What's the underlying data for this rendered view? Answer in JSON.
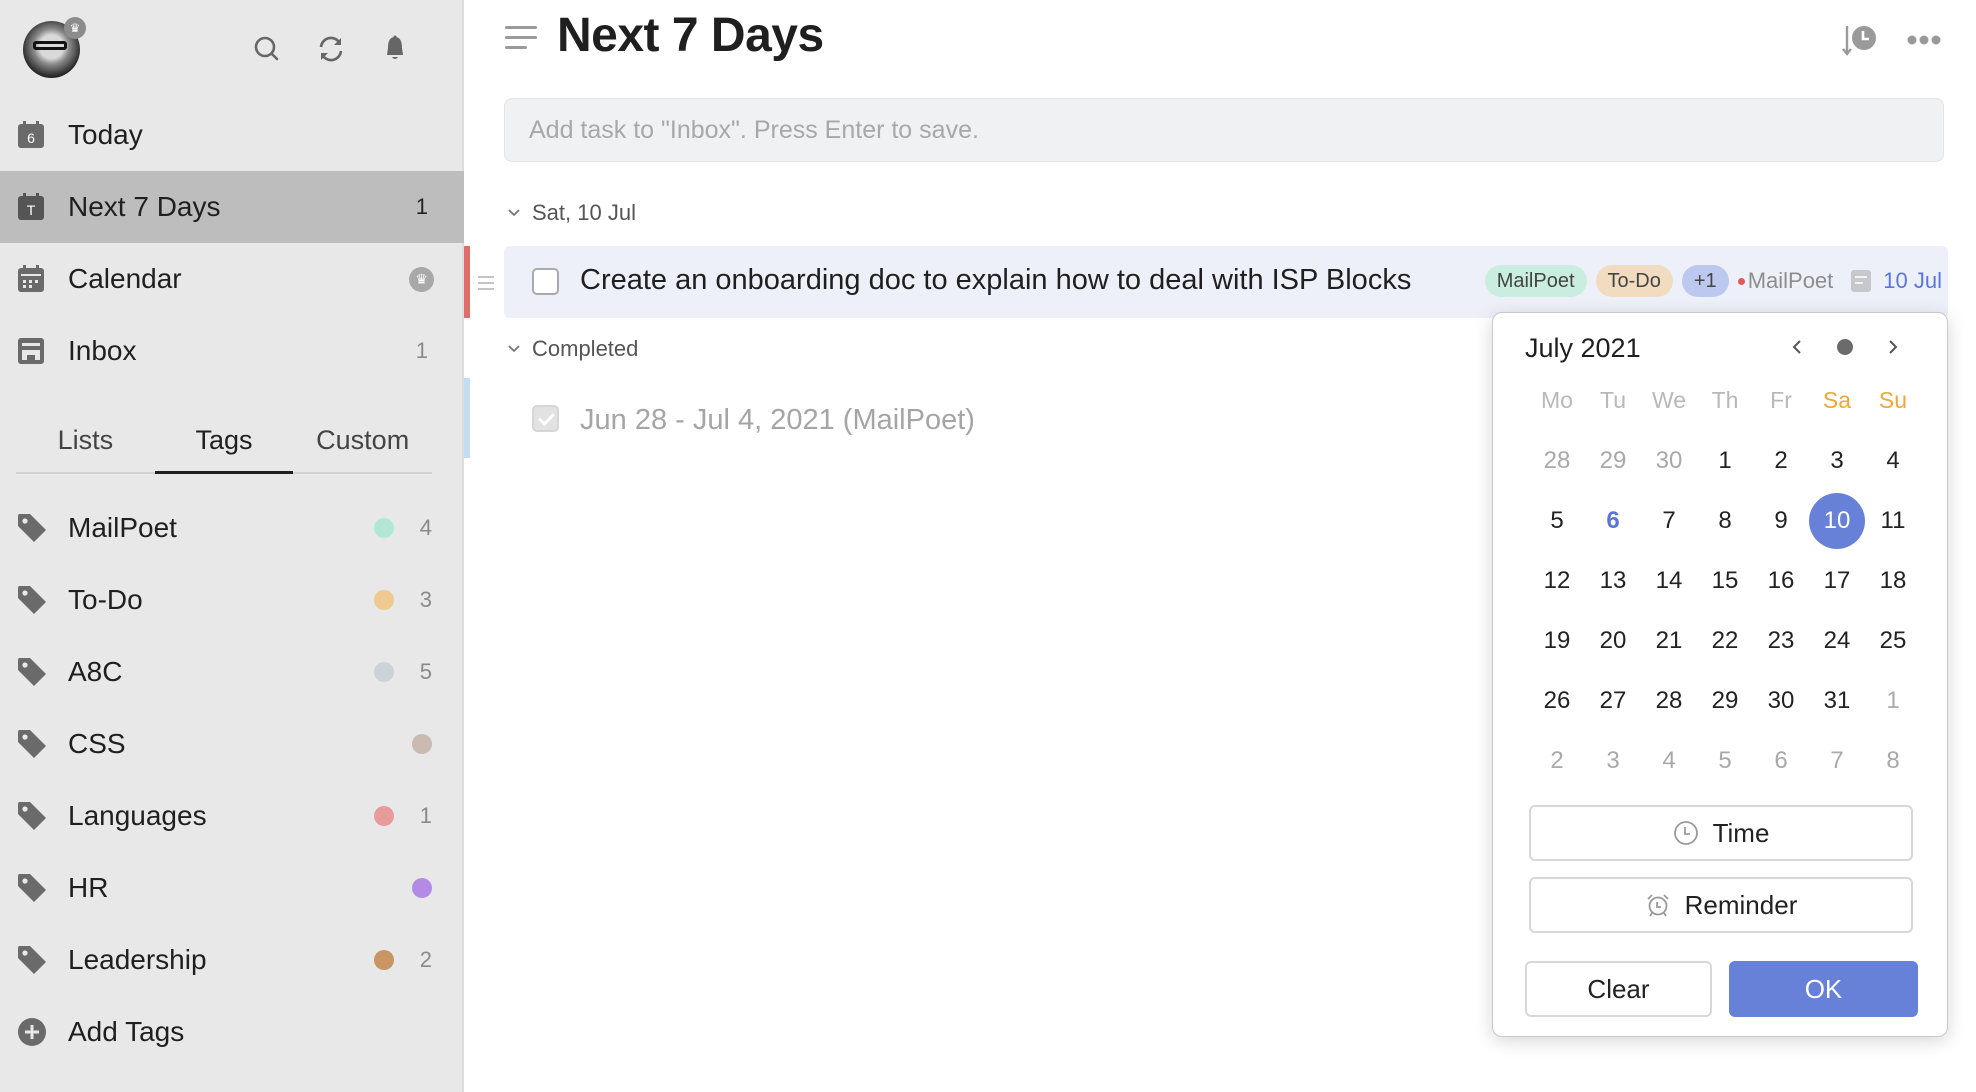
{
  "sidebar": {
    "avatar_badge": "♛",
    "header_icons": [
      "search-icon",
      "sync-icon",
      "bell-icon"
    ],
    "nav": [
      {
        "id": "today",
        "label": "Today",
        "icon_text": "6",
        "count": ""
      },
      {
        "id": "next-7-days",
        "label": "Next 7 Days",
        "icon_text": "T",
        "count": "1",
        "active": true
      },
      {
        "id": "calendar",
        "label": "Calendar",
        "icon_text": "",
        "count": "",
        "badge": "♛"
      },
      {
        "id": "inbox",
        "label": "Inbox",
        "icon_text": "",
        "count": "1"
      }
    ],
    "tabs": [
      {
        "label": "Lists"
      },
      {
        "label": "Tags",
        "active": true
      },
      {
        "label": "Custom"
      }
    ],
    "tags": [
      {
        "label": "MailPoet",
        "color": "#b2e8d3",
        "count": "4"
      },
      {
        "label": "To-Do",
        "color": "#efc98f",
        "count": "3"
      },
      {
        "label": "A8C",
        "color": "#ccd3d8",
        "count": "5"
      },
      {
        "label": "CSS",
        "color": "#cbbab1",
        "count": ""
      },
      {
        "label": "Languages",
        "color": "#e89b9b",
        "count": "1"
      },
      {
        "label": "HR",
        "color": "#b38be6",
        "count": ""
      },
      {
        "label": "Leadership",
        "color": "#c99563",
        "count": "2"
      }
    ],
    "add_tags_label": "Add Tags"
  },
  "main": {
    "title": "Next 7 Days",
    "add_task": {
      "value": "",
      "placeholder": "Add task to \"Inbox\". Press Enter to save."
    },
    "sections": [
      {
        "header": "Sat, 10 Jul",
        "tasks": [
          {
            "title": "Create an onboarding doc to explain how to deal with ISP Blocks",
            "priority_color": "#e06c6c",
            "tags": [
              {
                "label": "MailPoet",
                "bg": "#c9eee0"
              },
              {
                "label": "To-Do",
                "bg": "#f1dcc0"
              },
              {
                "label": "+1",
                "bg": "#bcc8ee"
              }
            ],
            "list": "MailPoet",
            "list_color": "#e05a5a",
            "has_note": true,
            "due": "10 Jul",
            "completed": false
          }
        ]
      },
      {
        "header": "Completed",
        "tasks": [
          {
            "title": "Jun 28 - Jul 4, 2021 (MailPoet)",
            "priority_color": "#c4ddf5",
            "completed": true
          }
        ]
      }
    ]
  },
  "date_picker": {
    "month_label": "July 2021",
    "weekdays": [
      "Mo",
      "Tu",
      "We",
      "Th",
      "Fr",
      "Sa",
      "Su"
    ],
    "weekend_color": "#f0a53a",
    "accent_color": "#6781d8",
    "today": "6",
    "selected": "10",
    "days": [
      [
        "28",
        "29",
        "30",
        "1",
        "2",
        "3",
        "4"
      ],
      [
        "5",
        "6",
        "7",
        "8",
        "9",
        "10",
        "11"
      ],
      [
        "12",
        "13",
        "14",
        "15",
        "16",
        "17",
        "18"
      ],
      [
        "19",
        "20",
        "21",
        "22",
        "23",
        "24",
        "25"
      ],
      [
        "26",
        "27",
        "28",
        "29",
        "30",
        "31",
        "1"
      ],
      [
        "2",
        "3",
        "4",
        "5",
        "6",
        "7",
        "8"
      ]
    ],
    "time_label": "Time",
    "reminder_label": "Reminder",
    "clear_label": "Clear",
    "ok_label": "OK"
  }
}
